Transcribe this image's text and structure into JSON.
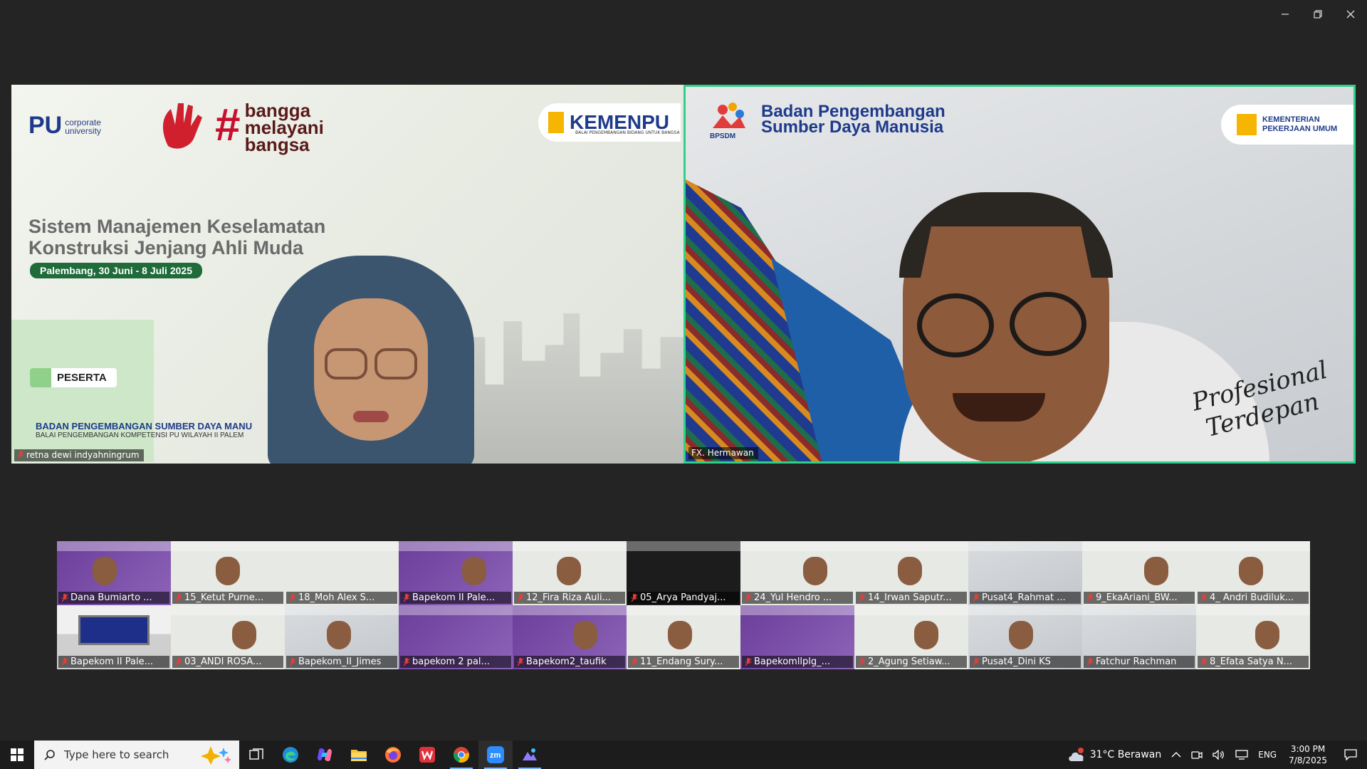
{
  "window": {
    "minimize": "–",
    "restore": "▢",
    "close": "✕"
  },
  "speakers": {
    "left": {
      "name": "retna dewi indyahningrum",
      "slide": {
        "pu_logo": "PU",
        "pu_sub": "corporate university",
        "hashtag": "#",
        "bangga": "bangga",
        "melayani": "melayani",
        "bangsa": "bangsa",
        "kemenpu": "KEMENPU",
        "kemenpu_sub": "BALAI PENGEMBANGAN BIDANG UNTUK BANGSA",
        "title_line1": "Sistem Manajemen Keselamatan",
        "title_line2": "Konstruksi Jenjang Ahli Muda",
        "date": "Palembang, 30 Juni - 8 Juli 2025",
        "role": "PESERTA",
        "footer": "BADAN PENGEMBANGAN SUMBER DAYA MANU",
        "footer_sub": "BALAI PENGEMBANGAN KOMPETENSI PU WILAYAH II PALEM"
      }
    },
    "right": {
      "name": "FX. Hermawan",
      "slide": {
        "bpsdm": "BPSDM",
        "org_line1": "Badan Pengembangan",
        "org_line2": "Sumber Daya Manusia",
        "kem_line1": "KEMENTERIAN",
        "kem_line2": "PEKERJAAN UMUM",
        "tagline_line1": "Profesional",
        "tagline_line2": "Terdepan"
      }
    }
  },
  "gallery": [
    {
      "name": "Dana Bumiarto ...",
      "style": "purple"
    },
    {
      "name": "15_Ketut Purne...",
      "style": "light"
    },
    {
      "name": "18_Moh Alex S...",
      "style": "light"
    },
    {
      "name": "Bapekom II Pale...",
      "style": "purple"
    },
    {
      "name": "12_Fira Riza Auli...",
      "style": "light"
    },
    {
      "name": "05_Arya Pandyaj...",
      "style": "dark"
    },
    {
      "name": "24_Yul Hendro ...",
      "style": "light"
    },
    {
      "name": "14_Irwan Saputr...",
      "style": "light"
    },
    {
      "name": "Pusat4_Rahmat ...",
      "style": "grey"
    },
    {
      "name": "9_EkaAriani_BW...",
      "style": "light"
    },
    {
      "name": "4_ Andri Budiluk...",
      "style": "light"
    },
    {
      "name": "Bapekom II Pale...",
      "style": "room"
    },
    {
      "name": "03_ANDI ROSA...",
      "style": "light"
    },
    {
      "name": "Bapekom_II_Jimes",
      "style": "grey"
    },
    {
      "name": "bapekom 2 pal...",
      "style": "purple"
    },
    {
      "name": "Bapekom2_taufik",
      "style": "purple"
    },
    {
      "name": "11_Endang Sury...",
      "style": "light"
    },
    {
      "name": "Bapekomllplg_...",
      "style": "purple"
    },
    {
      "name": "2_Agung Setiaw...",
      "style": "light"
    },
    {
      "name": "Pusat4_Dini KS",
      "style": "grey"
    },
    {
      "name": "Fatchur Rachman",
      "style": "grey"
    },
    {
      "name": "8_Efata Satya N...",
      "style": "light"
    }
  ],
  "taskbar": {
    "search_placeholder": "Type here to search",
    "weather": "31°C  Berawan",
    "weather_badge": "1",
    "language": "ENG",
    "time": "3:00 PM",
    "date": "7/8/2025"
  },
  "colors": {
    "active_speaker_border": "#2fd08a",
    "background": "#242424",
    "taskbar": "#1c1c1c",
    "muted_mic": "#e0413b"
  }
}
